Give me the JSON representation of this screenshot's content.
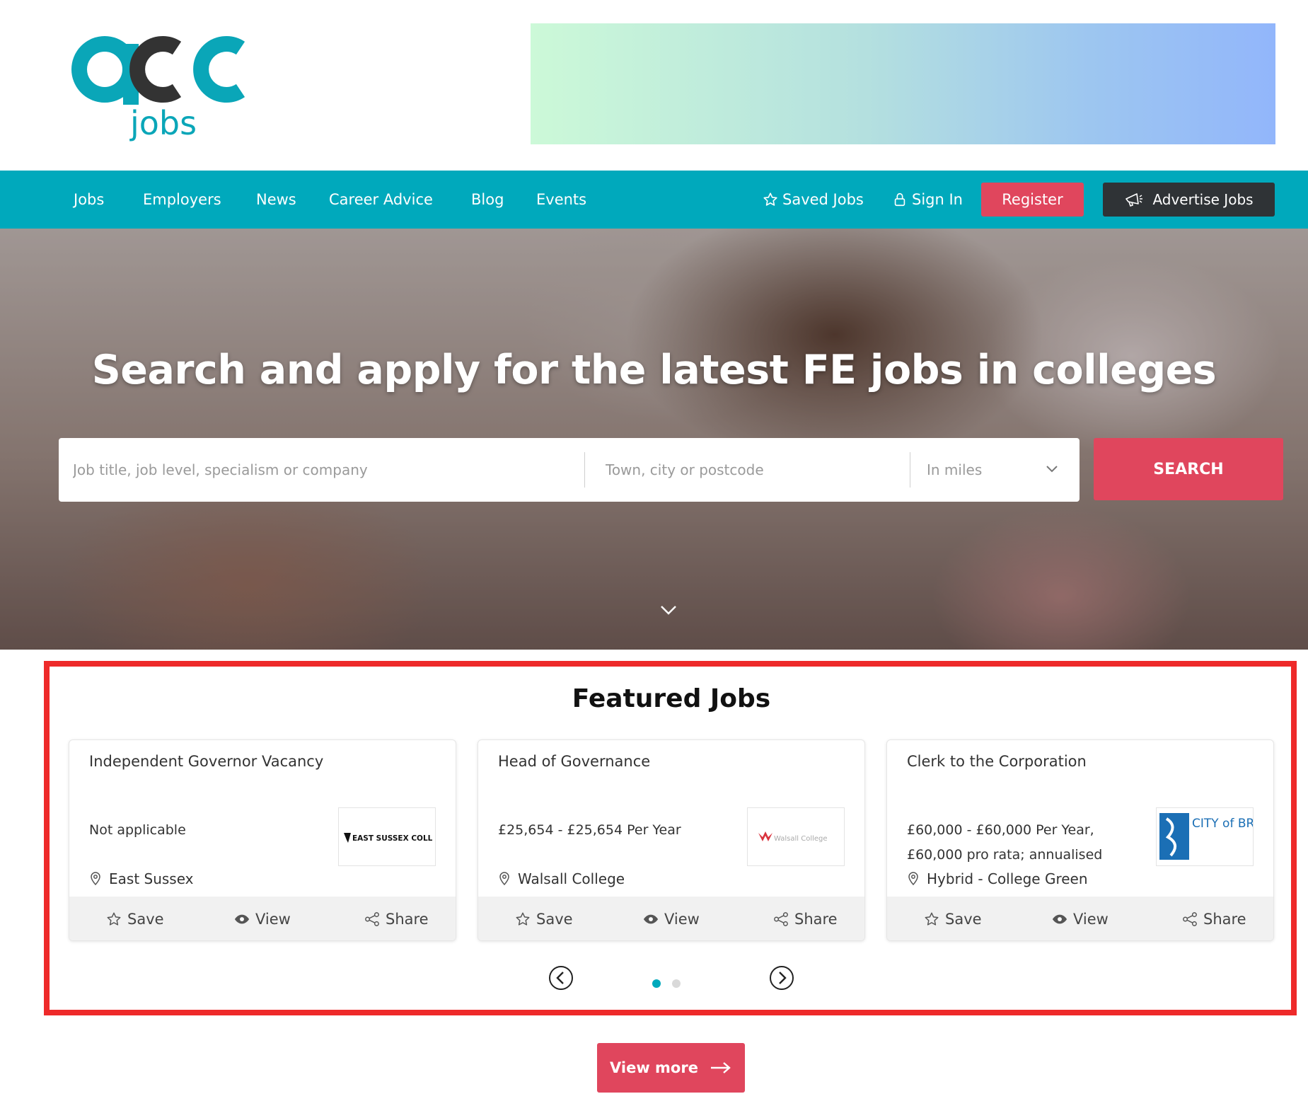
{
  "header": {
    "logo_text": "aoc jobs",
    "logo_word": "jobs"
  },
  "nav": {
    "links": [
      "Jobs",
      "Employers",
      "News",
      "Career Advice",
      "Blog",
      "Events"
    ],
    "saved_jobs": "Saved Jobs",
    "sign_in": "Sign In",
    "register": "Register",
    "advertise": "Advertise Jobs"
  },
  "hero": {
    "title": "Search and apply for the latest FE jobs in colleges",
    "keyword_placeholder": "Job title, job level, specialism or company",
    "location_placeholder": "Town, city or postcode",
    "radius_selected": "In miles",
    "search_label": "SEARCH"
  },
  "featured": {
    "title": "Featured Jobs",
    "cards": [
      {
        "title": "Independent Governor Vacancy",
        "salary": "Not applicable",
        "location": "East Sussex",
        "logo_text": "EAST SUSSEX COLLEGE"
      },
      {
        "title": "Head of Governance",
        "salary": "£25,654 - £25,654 Per Year",
        "location": "Walsall College",
        "logo_text": "Walsall College"
      },
      {
        "title": "Clerk to the Corporation",
        "salary": "£60,000 - £60,000 Per Year, £60,000 pro rata; annualised",
        "location": "Hybrid - College Green",
        "logo_text": "CITY of BRISTOL COLLEGE"
      }
    ],
    "actions": {
      "save": "Save",
      "view": "View",
      "share": "Share"
    },
    "carousel": {
      "page_count": 2,
      "active_page": 1
    }
  },
  "view_more": "View more",
  "colors": {
    "teal": "#00a9bc",
    "pink": "#e0465d",
    "dark": "#2f3336",
    "highlight_frame": "#ee2a2a"
  }
}
